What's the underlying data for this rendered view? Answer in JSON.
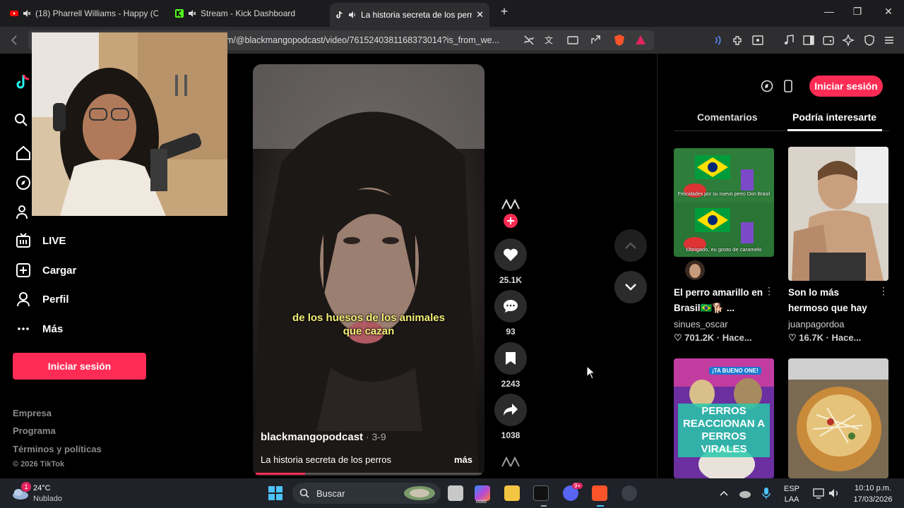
{
  "browser": {
    "tabs": [
      {
        "title": "(18) Pharrell Williams - Happy (Of",
        "active": false
      },
      {
        "title": "Stream - Kick Dashboard",
        "active": false
      },
      {
        "title": "La historia secreta de los perr",
        "active": true
      }
    ],
    "url": "m/@blackmangopodcast/video/7615240381168373014?is_from_we...",
    "controls": {
      "minimize": "—",
      "maximize": "❐",
      "close": "✕",
      "new_tab": "+",
      "tab_close": "✕"
    }
  },
  "sidebar": {
    "items": [
      {
        "label": "LIVE",
        "icon": "live-icon"
      },
      {
        "label": "Cargar",
        "icon": "upload-icon"
      },
      {
        "label": "Perfil",
        "icon": "profile-icon"
      },
      {
        "label": "Más",
        "icon": "more-icon"
      }
    ],
    "login_label": "Iniciar sesión",
    "footer": [
      "Empresa",
      "Programa",
      "Términos y políticas",
      "© 2026 TikTok"
    ]
  },
  "video": {
    "subtitle_line1": "de los huesos de los animales",
    "subtitle_line2": "que cazan",
    "author": "blackmangopodcast",
    "date": " · 3-9",
    "description": "La historia secreta de los perros",
    "more_label": "más",
    "progress": 0.22
  },
  "actions": {
    "likes": "25.1K",
    "comments": "93",
    "saves": "2243",
    "shares": "1038"
  },
  "right_panel": {
    "login_label": "Iniciar sesión",
    "tabs": [
      "Comentarios",
      "Podría interesarte"
    ],
    "cards": [
      {
        "title": "El perro amarillo en Brasil🇧🇷🐕 ...",
        "user": "sinues_oscar",
        "stats": "♡ 701.2K · Hace...",
        "overlay1": "Felicidades por su nuevo perro Don Brasil",
        "overlay2": "Obrigado, eu gosto de caramelo"
      },
      {
        "title": "Son lo más hermoso que hay",
        "user": "juanpagordoa",
        "stats": "♡ 16.7K · Hace..."
      },
      {
        "overlay": "PERROS REACCIONAN A PERROS VIRALES",
        "badge": "¡TA BUENO ONE!"
      },
      {}
    ]
  },
  "taskbar": {
    "weather_temp": "24°C",
    "weather_desc": "Nublado",
    "weather_badge": "1",
    "search_label": "Buscar",
    "lang1": "ESP",
    "lang2": "LAA",
    "time": "10:10 p.m.",
    "date": "17/03/2026",
    "discord_badge": "9+",
    "m365_label": "M365"
  },
  "colors": {
    "accent": "#fe2c55",
    "subtitle": "#f6f07a"
  }
}
